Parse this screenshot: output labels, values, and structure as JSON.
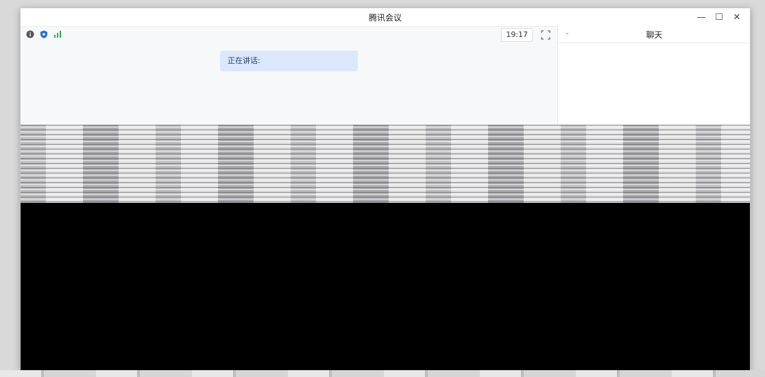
{
  "window": {
    "title": "腾讯会议",
    "controls": {
      "minimize": "—",
      "maximize": "☐",
      "close": "✕"
    }
  },
  "toolbar": {
    "icons": [
      "info-icon",
      "shield-icon",
      "signal-icon"
    ],
    "time": "19:17"
  },
  "main": {
    "speaking_label": "正在讲话:"
  },
  "chat": {
    "title": "聊天",
    "collapse_glyph": "⌄"
  },
  "colors": {
    "shield": "#1f6fe5",
    "signal": "#22b04a",
    "speaking_bg": "#dbe8fb"
  }
}
